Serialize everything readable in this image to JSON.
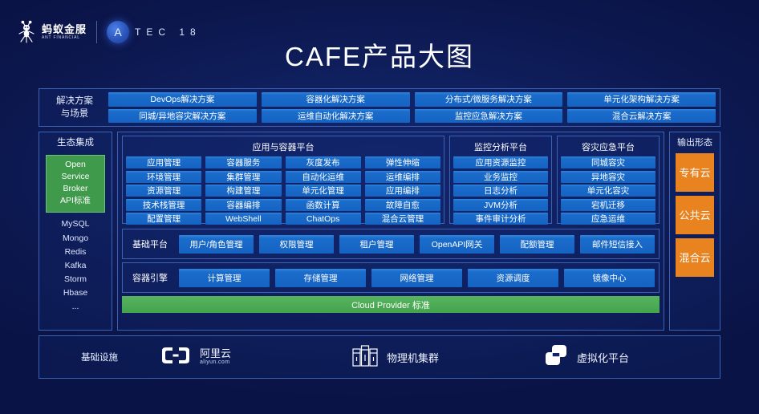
{
  "brand": {
    "ant_cn": "蚂蚁金服",
    "ant_en": "ANT FINANCIAL",
    "atec_letter": "A",
    "atec_word": "TEC 18"
  },
  "title": "CAFE产品大图",
  "solutions": {
    "label": "解决方案\n与场景",
    "label_line1": "解决方案",
    "label_line2": "与场景",
    "row1": [
      "DevOps解决方案",
      "容器化解决方案",
      "分布式/微服务解决方案",
      "单元化架构解决方案"
    ],
    "row2": [
      "同城/异地容灾解决方案",
      "运维自动化解决方案",
      "监控应急解决方案",
      "混合云解决方案"
    ]
  },
  "ecosystem": {
    "label": "生态集成",
    "osb_lines": [
      "Open",
      "Service",
      "Broker",
      "API标准"
    ],
    "items": [
      "MySQL",
      "Mongo",
      "Redis",
      "Kafka",
      "Storm",
      "Hbase",
      "..."
    ]
  },
  "app_platform": {
    "title": "应用与容器平台",
    "columns": [
      [
        "应用管理",
        "环境管理",
        "资源管理",
        "技术栈管理",
        "配置管理"
      ],
      [
        "容器服务",
        "集群管理",
        "构建管理",
        "容器编排",
        "WebShell"
      ],
      [
        "灰度发布",
        "自动化运维",
        "单元化管理",
        "函数计算",
        "ChatOps"
      ],
      [
        "弹性伸缩",
        "运维编排",
        "应用编排",
        "故障自愈",
        "混合云管理"
      ]
    ]
  },
  "monitor_platform": {
    "title": "监控分析平台",
    "items": [
      "应用资源监控",
      "业务监控",
      "日志分析",
      "JVM分析",
      "事件审计分析"
    ]
  },
  "dr_platform": {
    "title": "容灾应急平台",
    "items": [
      "同城容灾",
      "异地容灾",
      "单元化容灾",
      "宕机迁移",
      "应急运维"
    ]
  },
  "base_platform": {
    "label": "基础平台",
    "items": [
      "用户/角色管理",
      "权限管理",
      "租户管理",
      "OpenAPI网关",
      "配额管理",
      "邮件短信接入"
    ]
  },
  "container_engine": {
    "label": "容器引擎",
    "items": [
      "计算管理",
      "存储管理",
      "网络管理",
      "资源调度",
      "镜像中心"
    ]
  },
  "cloud_provider_bar": "Cloud Provider 标准",
  "output": {
    "label": "输出形态",
    "items": [
      "专有云",
      "公共云",
      "混合云"
    ]
  },
  "infrastructure": {
    "label": "基础设施",
    "aliyun_cn": "阿里云",
    "aliyun_en": "aliyun.com",
    "physical": "物理机集群",
    "virtual": "虚拟化平台"
  },
  "colors": {
    "background": "#0c1850",
    "button_blue": "#1a6ccb",
    "accent_green": "#3f9a4b",
    "accent_orange": "#e8831f",
    "border_blue": "#3b62b4"
  }
}
